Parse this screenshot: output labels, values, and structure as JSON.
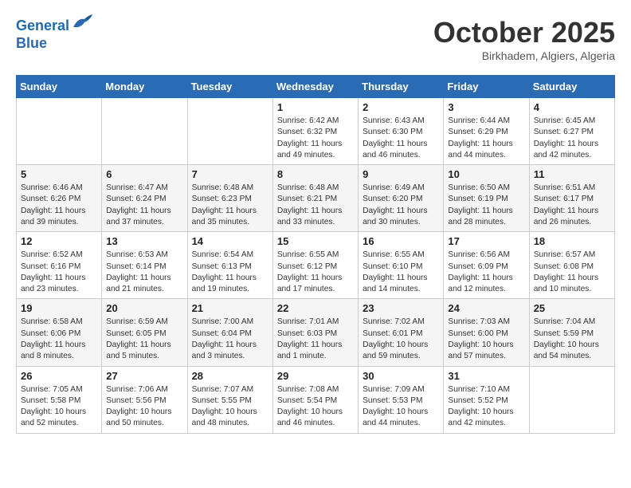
{
  "header": {
    "logo_line1": "General",
    "logo_line2": "Blue",
    "month": "October 2025",
    "location": "Birkhadem, Algiers, Algeria"
  },
  "days_of_week": [
    "Sunday",
    "Monday",
    "Tuesday",
    "Wednesday",
    "Thursday",
    "Friday",
    "Saturday"
  ],
  "weeks": [
    [
      {
        "day": "",
        "content": ""
      },
      {
        "day": "",
        "content": ""
      },
      {
        "day": "",
        "content": ""
      },
      {
        "day": "1",
        "content": "Sunrise: 6:42 AM\nSunset: 6:32 PM\nDaylight: 11 hours\nand 49 minutes."
      },
      {
        "day": "2",
        "content": "Sunrise: 6:43 AM\nSunset: 6:30 PM\nDaylight: 11 hours\nand 46 minutes."
      },
      {
        "day": "3",
        "content": "Sunrise: 6:44 AM\nSunset: 6:29 PM\nDaylight: 11 hours\nand 44 minutes."
      },
      {
        "day": "4",
        "content": "Sunrise: 6:45 AM\nSunset: 6:27 PM\nDaylight: 11 hours\nand 42 minutes."
      }
    ],
    [
      {
        "day": "5",
        "content": "Sunrise: 6:46 AM\nSunset: 6:26 PM\nDaylight: 11 hours\nand 39 minutes."
      },
      {
        "day": "6",
        "content": "Sunrise: 6:47 AM\nSunset: 6:24 PM\nDaylight: 11 hours\nand 37 minutes."
      },
      {
        "day": "7",
        "content": "Sunrise: 6:48 AM\nSunset: 6:23 PM\nDaylight: 11 hours\nand 35 minutes."
      },
      {
        "day": "8",
        "content": "Sunrise: 6:48 AM\nSunset: 6:21 PM\nDaylight: 11 hours\nand 33 minutes."
      },
      {
        "day": "9",
        "content": "Sunrise: 6:49 AM\nSunset: 6:20 PM\nDaylight: 11 hours\nand 30 minutes."
      },
      {
        "day": "10",
        "content": "Sunrise: 6:50 AM\nSunset: 6:19 PM\nDaylight: 11 hours\nand 28 minutes."
      },
      {
        "day": "11",
        "content": "Sunrise: 6:51 AM\nSunset: 6:17 PM\nDaylight: 11 hours\nand 26 minutes."
      }
    ],
    [
      {
        "day": "12",
        "content": "Sunrise: 6:52 AM\nSunset: 6:16 PM\nDaylight: 11 hours\nand 23 minutes."
      },
      {
        "day": "13",
        "content": "Sunrise: 6:53 AM\nSunset: 6:14 PM\nDaylight: 11 hours\nand 21 minutes."
      },
      {
        "day": "14",
        "content": "Sunrise: 6:54 AM\nSunset: 6:13 PM\nDaylight: 11 hours\nand 19 minutes."
      },
      {
        "day": "15",
        "content": "Sunrise: 6:55 AM\nSunset: 6:12 PM\nDaylight: 11 hours\nand 17 minutes."
      },
      {
        "day": "16",
        "content": "Sunrise: 6:55 AM\nSunset: 6:10 PM\nDaylight: 11 hours\nand 14 minutes."
      },
      {
        "day": "17",
        "content": "Sunrise: 6:56 AM\nSunset: 6:09 PM\nDaylight: 11 hours\nand 12 minutes."
      },
      {
        "day": "18",
        "content": "Sunrise: 6:57 AM\nSunset: 6:08 PM\nDaylight: 11 hours\nand 10 minutes."
      }
    ],
    [
      {
        "day": "19",
        "content": "Sunrise: 6:58 AM\nSunset: 6:06 PM\nDaylight: 11 hours\nand 8 minutes."
      },
      {
        "day": "20",
        "content": "Sunrise: 6:59 AM\nSunset: 6:05 PM\nDaylight: 11 hours\nand 5 minutes."
      },
      {
        "day": "21",
        "content": "Sunrise: 7:00 AM\nSunset: 6:04 PM\nDaylight: 11 hours\nand 3 minutes."
      },
      {
        "day": "22",
        "content": "Sunrise: 7:01 AM\nSunset: 6:03 PM\nDaylight: 11 hours\nand 1 minute."
      },
      {
        "day": "23",
        "content": "Sunrise: 7:02 AM\nSunset: 6:01 PM\nDaylight: 10 hours\nand 59 minutes."
      },
      {
        "day": "24",
        "content": "Sunrise: 7:03 AM\nSunset: 6:00 PM\nDaylight: 10 hours\nand 57 minutes."
      },
      {
        "day": "25",
        "content": "Sunrise: 7:04 AM\nSunset: 5:59 PM\nDaylight: 10 hours\nand 54 minutes."
      }
    ],
    [
      {
        "day": "26",
        "content": "Sunrise: 7:05 AM\nSunset: 5:58 PM\nDaylight: 10 hours\nand 52 minutes."
      },
      {
        "day": "27",
        "content": "Sunrise: 7:06 AM\nSunset: 5:56 PM\nDaylight: 10 hours\nand 50 minutes."
      },
      {
        "day": "28",
        "content": "Sunrise: 7:07 AM\nSunset: 5:55 PM\nDaylight: 10 hours\nand 48 minutes."
      },
      {
        "day": "29",
        "content": "Sunrise: 7:08 AM\nSunset: 5:54 PM\nDaylight: 10 hours\nand 46 minutes."
      },
      {
        "day": "30",
        "content": "Sunrise: 7:09 AM\nSunset: 5:53 PM\nDaylight: 10 hours\nand 44 minutes."
      },
      {
        "day": "31",
        "content": "Sunrise: 7:10 AM\nSunset: 5:52 PM\nDaylight: 10 hours\nand 42 minutes."
      },
      {
        "day": "",
        "content": ""
      }
    ]
  ]
}
